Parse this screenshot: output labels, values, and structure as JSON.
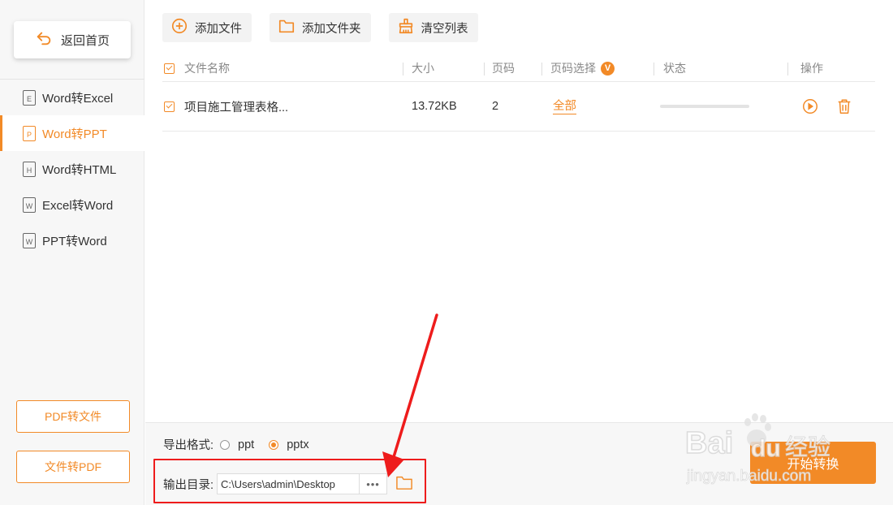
{
  "sidebar": {
    "home_label": "返回首页",
    "items": [
      {
        "label": "Word转Excel",
        "icon_letter": "E",
        "active": false
      },
      {
        "label": "Word转PPT",
        "icon_letter": "P",
        "active": true
      },
      {
        "label": "Word转HTML",
        "icon_letter": "H",
        "active": false
      },
      {
        "label": "Excel转Word",
        "icon_letter": "W",
        "active": false
      },
      {
        "label": "PPT转Word",
        "icon_letter": "W",
        "active": false
      }
    ],
    "pdf_to_file": "PDF转文件",
    "file_to_pdf": "文件转PDF"
  },
  "toolbar": {
    "add_file": "添加文件",
    "add_folder": "添加文件夹",
    "clear_list": "清空列表"
  },
  "table": {
    "headers": {
      "name": "文件名称",
      "size": "大小",
      "pages": "页码",
      "page_select": "页码选择",
      "page_select_badge": "V",
      "status": "状态",
      "actions": "操作"
    },
    "rows": [
      {
        "name": "项目施工管理表格...",
        "size": "13.72KB",
        "pages": "2",
        "page_select": "全部",
        "progress": 0
      }
    ]
  },
  "bottom": {
    "format_label": "导出格式:",
    "format_options": [
      "ppt",
      "pptx"
    ],
    "format_selected": "pptx",
    "output_label": "输出目录:",
    "output_path": "C:\\Users\\admin\\Desktop",
    "browse_dots": "•••",
    "start_label": "开始转换"
  },
  "watermark": {
    "text": "Baidu经验",
    "url": "jingyan.baidu.com"
  },
  "colors": {
    "accent": "#f28a27",
    "highlight": "#ee1c1c"
  }
}
